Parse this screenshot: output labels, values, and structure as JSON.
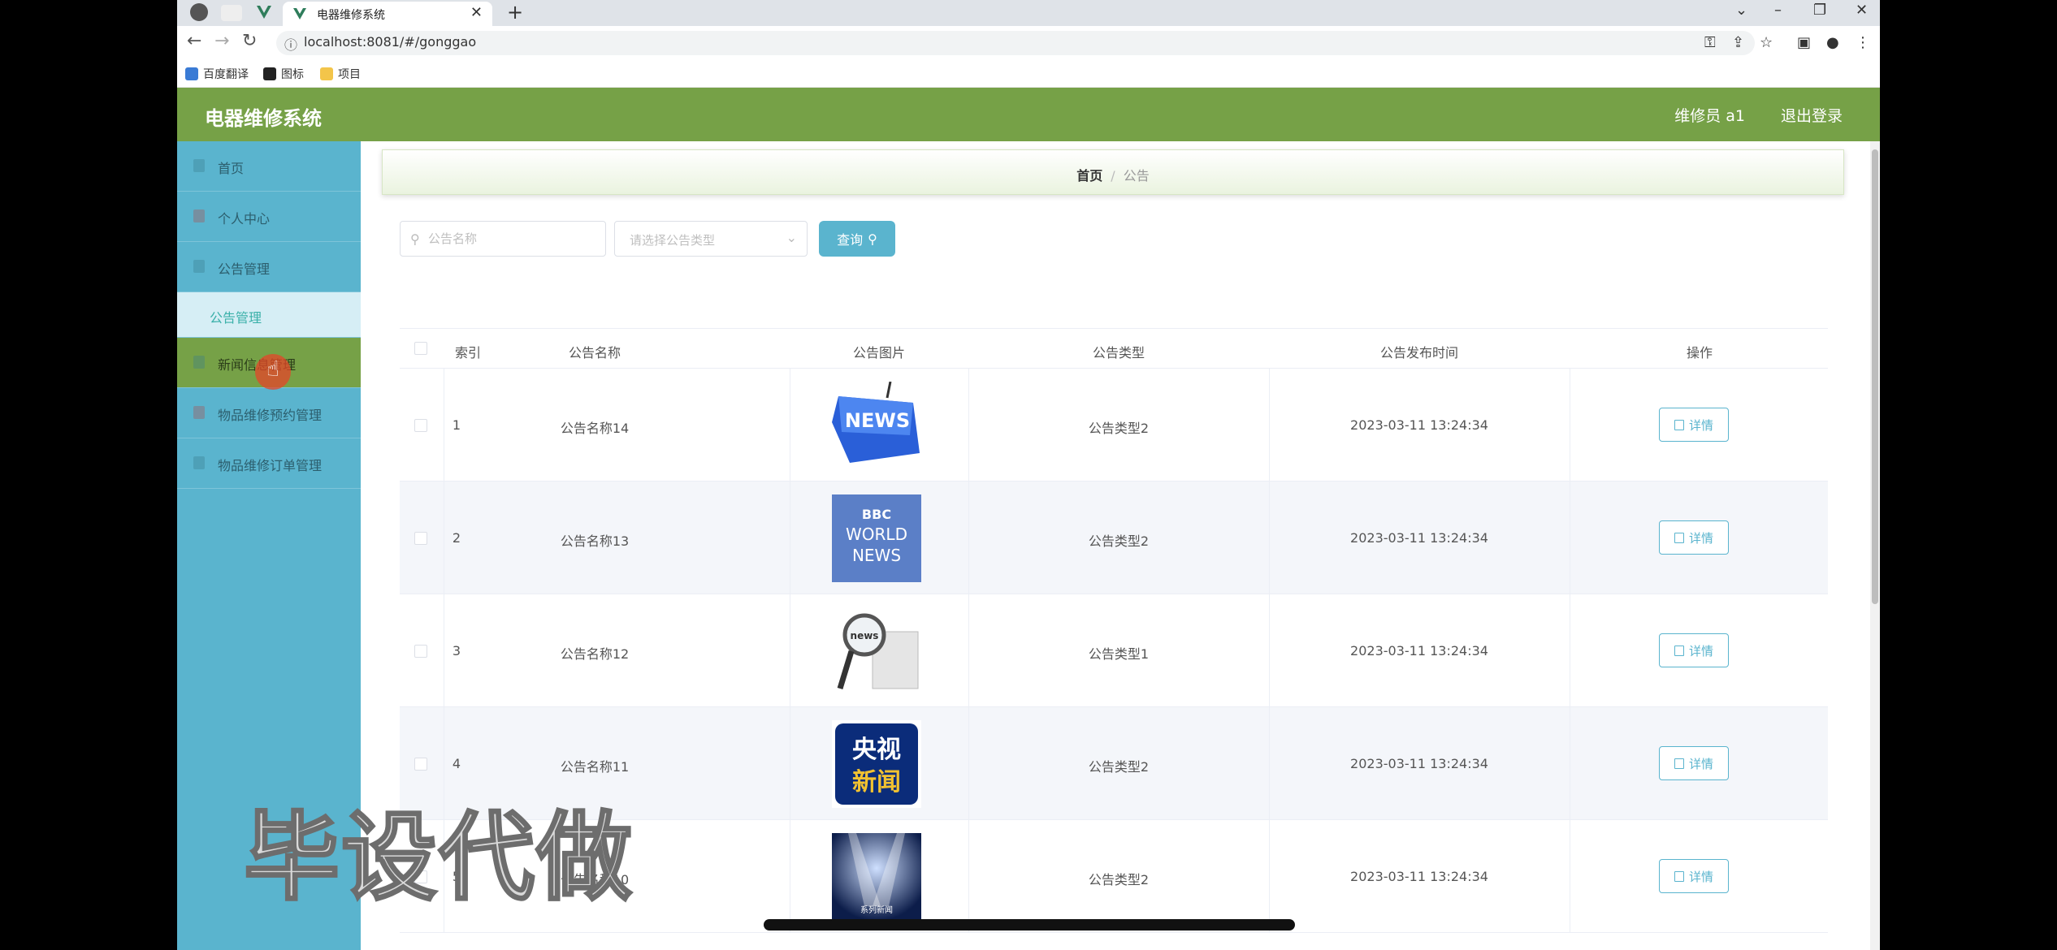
{
  "browser": {
    "tab_title": "电器维修系统",
    "url": "localhost:8081/#/gonggao",
    "bookmarks": [
      "百度翻译",
      "图标",
      "项目"
    ]
  },
  "header": {
    "app_title": "电器维修系统",
    "user": "维修员 a1",
    "logout": "退出登录"
  },
  "sidebar": {
    "items": [
      {
        "label": "首页"
      },
      {
        "label": "个人中心"
      },
      {
        "label": "公告管理"
      },
      {
        "label": "公告管理",
        "sub": true
      },
      {
        "label": "新闻信息管理"
      },
      {
        "label": "物品维修预约管理"
      },
      {
        "label": "物品维修订单管理"
      }
    ]
  },
  "breadcrumb": {
    "home": "首页",
    "separator": "/",
    "current": "公告"
  },
  "search": {
    "name_placeholder": "公告名称",
    "type_placeholder": "请选择公告类型",
    "query_label": "查询"
  },
  "table": {
    "headers": [
      "索引",
      "公告名称",
      "公告图片",
      "公告类型",
      "公告发布时间",
      "操作"
    ],
    "rows": [
      {
        "index": "1",
        "name": "公告名称14",
        "image": "news-keyboard-image",
        "type": "公告类型2",
        "time": "2023-03-11 13:24:34",
        "action": "详情"
      },
      {
        "index": "2",
        "name": "公告名称13",
        "image": "bbc-world-news-image",
        "type": "公告类型2",
        "time": "2023-03-11 13:24:34",
        "action": "详情"
      },
      {
        "index": "3",
        "name": "公告名称12",
        "image": "magnifier-news-image",
        "type": "公告类型1",
        "time": "2023-03-11 13:24:34",
        "action": "详情"
      },
      {
        "index": "4",
        "name": "公告名称11",
        "image": "cctv-news-image",
        "type": "公告类型2",
        "time": "2023-03-11 13:24:34",
        "action": "详情"
      },
      {
        "index": "5",
        "name": "公告名称10",
        "image": "stage-lights-image",
        "type": "公告类型2",
        "time": "2023-03-11 13:24:34",
        "action": "详情"
      }
    ]
  },
  "thumb_text": {
    "news": "NEWS",
    "bbc1": "BBC",
    "bbc2": "WORLD",
    "bbc3": "NEWS",
    "mag": "news",
    "cctv1": "央视",
    "cctv2": "新闻",
    "stage": "系列新闻"
  },
  "overlay": {
    "watermark": "毕设代做"
  },
  "colors": {
    "header": "#76a147",
    "sidebar": "#5ab4ce",
    "accent": "#5ab4ce"
  }
}
